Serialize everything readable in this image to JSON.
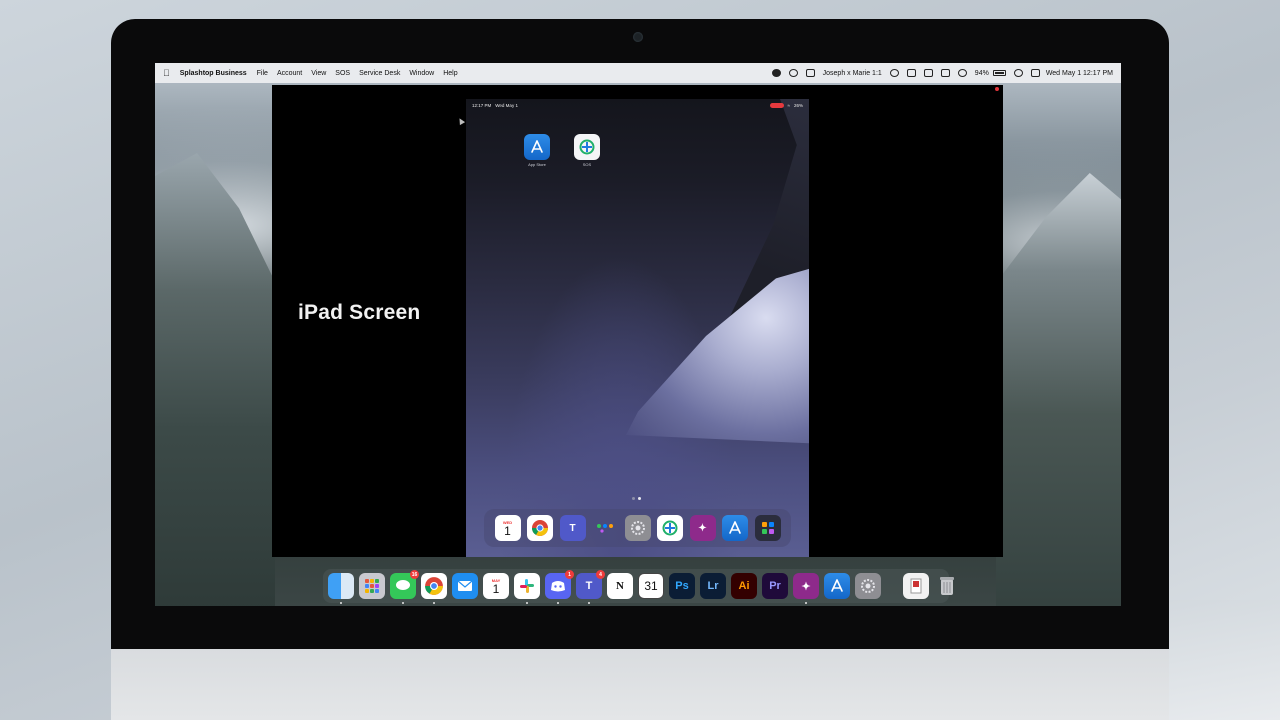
{
  "menubar": {
    "app_name": "Splashtop Business",
    "menus": [
      "File",
      "Account",
      "View",
      "SOS",
      "Service Desk",
      "Window",
      "Help"
    ],
    "session": "Joseph x Marie 1:1",
    "battery": "94%",
    "datetime": "Wed May 1  12:17 PM"
  },
  "viewer": {
    "caption": "iPad Screen"
  },
  "ipad": {
    "status_time": "12:17 PM",
    "status_date": "Wed May 1",
    "battery": "26%",
    "home_apps": [
      {
        "label": "App Store",
        "icon": "app-store-icon"
      },
      {
        "label": "SOS",
        "icon": "sos-icon"
      }
    ],
    "dock": {
      "calendar_month": "WED",
      "calendar_day": "1",
      "apps": [
        "calendar-icon",
        "chrome-icon",
        "teams-icon",
        "folder-icon",
        "settings-icon",
        "sos-icon",
        "splashtop-icon",
        "app-store-icon",
        "app-library-icon"
      ]
    }
  },
  "mac_dock": {
    "messages_badge": "16",
    "calendar_month": "MAY",
    "calendar_day": "1",
    "discord_badge": "1",
    "teams_badge": "4",
    "gcal_day": "31",
    "ps": "Ps",
    "lr": "Lr",
    "ai": "Ai",
    "pr": "Pr",
    "notion": "N"
  },
  "colors": {
    "accent_blue": "#1f7ae0",
    "record_red": "#e5393e",
    "badge_red": "#ef3b3b"
  }
}
